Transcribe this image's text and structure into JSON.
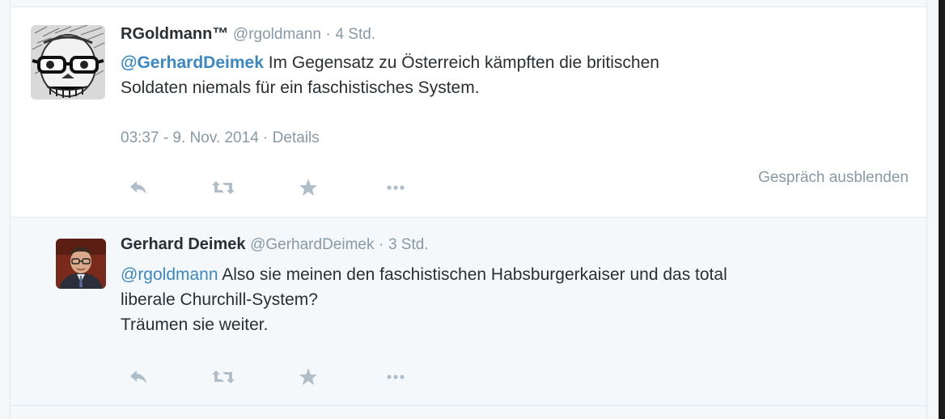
{
  "tweet": {
    "author_name": "RGoldmann™",
    "handle": "@rgoldmann",
    "separator": "·",
    "time": "4 Std.",
    "mention": "@GerhardDeimek",
    "text_line1": " Im Gegensatz zu Österreich kämpften die britischen",
    "text_line2": "Soldaten niemals für ein faschistisches System.",
    "timestamp": "03:37 - 9. Nov. 2014",
    "details_separator": " · ",
    "details_label": "Details",
    "hide_conversation_label": "Gespräch ausblenden",
    "avatar_icon": "skull-with-glasses-avatar-icon"
  },
  "reply": {
    "author_name": "Gerhard Deimek",
    "handle": "@GerhardDeimek",
    "separator": "·",
    "time": "3 Std.",
    "mention": "@rgoldmann",
    "text_line1": " Also sie meinen den faschistischen Habsburgerkaiser und das total",
    "text_line2": "liberale Churchill-System?",
    "text_line3": "Träumen sie weiter.",
    "avatar_icon": "man-with-glasses-avatar-icon"
  },
  "actions": {
    "reply_icon": "reply-icon",
    "retweet_icon": "retweet-icon",
    "favorite_icon": "star-icon",
    "more_icon": "more-dots-icon"
  },
  "colors": {
    "link": "#3b88c3",
    "secondary_text": "#8899a6",
    "primary_text": "#292f33",
    "action_icon": "#afbec8",
    "conversation_background": "#f5f8fa"
  }
}
